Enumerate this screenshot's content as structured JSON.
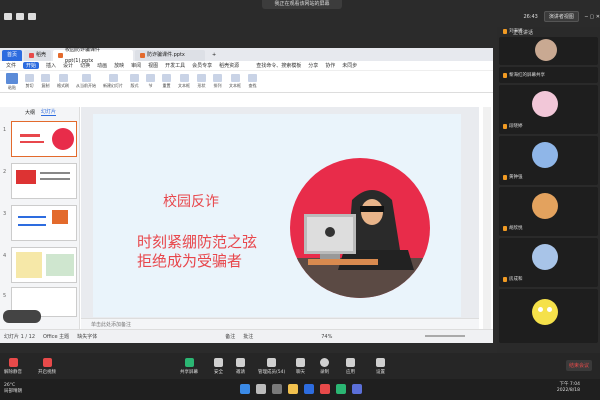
{
  "meeting": {
    "banner": "我正在观看该网站的屏幕",
    "time": "26:43",
    "view_label": "演讲者视图"
  },
  "wps": {
    "tabs": {
      "home": "首页",
      "wps": "稻壳",
      "active": "校园防诈骗课件ppt(1).pptx",
      "other": "防诈骗课件.pptx",
      "add": "+"
    },
    "menu": [
      "文件",
      "开始",
      "插入",
      "设计",
      "切换",
      "动画",
      "放映",
      "审阅",
      "视图",
      "开发工具",
      "会员专享",
      "稻壳资源"
    ],
    "menu_active": "开始",
    "search": "查找命令、搜索模板",
    "share": "分享",
    "collab": "协作",
    "unsync": "未同步",
    "ribbon": [
      {
        "label": "粘贴"
      },
      {
        "label": "剪切"
      },
      {
        "label": "复制"
      },
      {
        "label": "格式刷"
      },
      {
        "label": "从当前开始"
      },
      {
        "label": "新建幻灯片"
      },
      {
        "label": "版式"
      },
      {
        "label": "节"
      },
      {
        "label": "重置"
      },
      {
        "label": "文本框"
      },
      {
        "label": "形状"
      },
      {
        "label": "排列"
      },
      {
        "label": "文本框"
      },
      {
        "label": "查找"
      }
    ],
    "panel_tabs": [
      "大纲",
      "幻灯片"
    ],
    "slide": {
      "title": "校园反诈",
      "line1": "时刻紧绷防范之弦",
      "line2": "拒绝成为受骗者"
    },
    "notes": "单击此处添加备注",
    "status": {
      "page": "幻灯片 1 / 12",
      "theme": "Office 主题",
      "font": "缺失字体",
      "note": "备注",
      "comment": "批注",
      "zoom": "74%"
    }
  },
  "participants": {
    "header": "正在讲话",
    "people": [
      {
        "name": "刘海博"
      },
      {
        "name": "黎海红的屏幕共享"
      },
      {
        "name": "段晓婷"
      },
      {
        "name": "黄钟强"
      },
      {
        "name": "胡欣悦"
      },
      {
        "name": "房成和"
      },
      {
        "name": ""
      }
    ]
  },
  "meeting_bar": {
    "mic": "解除静音",
    "video": "开启视频",
    "share": "共享屏幕",
    "security": "安全",
    "invite": "邀请",
    "members": "管理成员(54)",
    "chat": "聊天",
    "record": "录制",
    "apps": "应用",
    "settings": "设置",
    "end": "结束会议"
  },
  "taskbar": {
    "weather_temp": "26°C",
    "weather_desc": "局部晴朗",
    "time": "下午 7:04",
    "date": "2022/8/18"
  }
}
